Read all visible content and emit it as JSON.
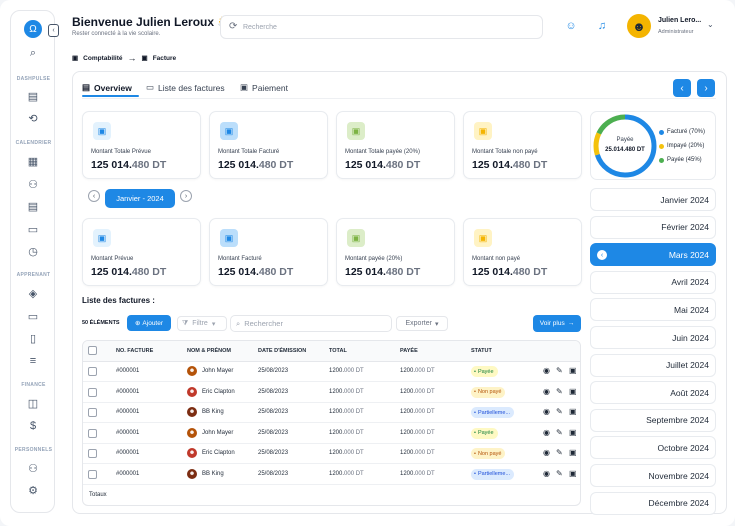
{
  "header": {
    "title": "Bienvenue Julien Leroux",
    "wave": "👋",
    "subtitle": "Rester connecté à la vie scolaire.",
    "search_placeholder": "Recherche"
  },
  "user": {
    "name": "Julien Leroux",
    "name_short": "Julien Lero...",
    "role": "Administrateur"
  },
  "breadcrumb": {
    "first": "Comptabilité",
    "second": "Facture"
  },
  "sidebar": {
    "sections": [
      "DASHPULSE",
      "CALENDRIER",
      "APPRENANT",
      "FINANCE",
      "PERSONNELS"
    ]
  },
  "tabs": [
    {
      "label": "Overview",
      "icon": "overview-icon"
    },
    {
      "label": "Liste des factures",
      "icon": "list-icon"
    },
    {
      "label": "Paiement",
      "icon": "payment-icon"
    }
  ],
  "summary_cards": [
    {
      "label": "Montant Totale Prévue",
      "value": "125 014.",
      "dec": "480 DT",
      "icon": "wallet-icon",
      "color": "#e3f2fd",
      "icolor": "#1e88e5"
    },
    {
      "label": "Montant Totale Facturé",
      "value": "125 014.",
      "dec": "480 DT",
      "icon": "clipboard-icon",
      "color": "#bbdefb",
      "icolor": "#1e88e5"
    },
    {
      "label": "Montant Totale payée (20%)",
      "value": "125 014.",
      "dec": "480 DT",
      "icon": "cash-icon",
      "color": "#dcedc8",
      "icolor": "#7cb342"
    },
    {
      "label": "Montant Totale non payé",
      "value": "125 014.",
      "dec": "480 DT",
      "icon": "cash-icon",
      "color": "#fff3c4",
      "icolor": "#f4b400"
    }
  ],
  "month_selector": {
    "label": "Janvier - 2024"
  },
  "month_cards": [
    {
      "label": "Montant  Prévue",
      "value": "125 014.",
      "dec": "480 DT"
    },
    {
      "label": "Montant  Facturé",
      "value": "125 014.",
      "dec": "480 DT"
    },
    {
      "label": "Montant  payée (20%)",
      "value": "125 014.",
      "dec": "480 DT"
    },
    {
      "label": "Montant  non payé",
      "value": "125 014.",
      "dec": "480 DT"
    }
  ],
  "ring": {
    "center_label": "Payée",
    "center_value": "25.014.480 DT",
    "legend": [
      {
        "label": "Facturé (70%)",
        "color": "#1e88e5",
        "pct": 70
      },
      {
        "label": "Impayé (20%)",
        "color": "#f4c20d",
        "pct": 20
      },
      {
        "label": "Payée (45%)",
        "color": "#4caf50",
        "pct": 45
      }
    ]
  },
  "months": [
    "Janvier 2024",
    "Février 2024",
    "Mars 2024",
    "Avril 2024",
    "Mai 2024",
    "Juin 2024",
    "Juillet 2024",
    "Août 2024",
    "Septembre 2024",
    "Octobre 2024",
    "Novembre 2024",
    "Décembre 2024"
  ],
  "active_month_index": 2,
  "list": {
    "title": "Liste des factures :",
    "count": "50 ÉLÉMENTS",
    "add": "Ajouter",
    "filter": "Filtre",
    "search_placeholder": "Rechercher",
    "export": "Exporter",
    "more": "Voir plus",
    "columns": [
      "NO. FACTURE",
      "NOM & PRÉNOM",
      "DATE D'ÉMISSION",
      "TOTAL",
      "PAYÉE",
      "STATUT"
    ],
    "totals_label": "Totaux",
    "rows": [
      {
        "no": "#000001",
        "name": "John Mayer",
        "date": "25/08/2023",
        "total": "1200.",
        "total_dec": "000 DT",
        "paid": "1200.",
        "paid_dec": "000 DT",
        "status": "Payée",
        "status_type": "green"
      },
      {
        "no": "#000001",
        "name": "Eric Clapton",
        "date": "25/08/2023",
        "total": "1200.",
        "total_dec": "000 DT",
        "paid": "1200.",
        "paid_dec": "000 DT",
        "status": "Non payé",
        "status_type": "orange"
      },
      {
        "no": "#000001",
        "name": "BB King",
        "date": "25/08/2023",
        "total": "1200.",
        "total_dec": "000 DT",
        "paid": "1200.",
        "paid_dec": "000 DT",
        "status": "Partielleme...",
        "status_type": "blue"
      },
      {
        "no": "#000001",
        "name": "John Mayer",
        "date": "25/08/2023",
        "total": "1200.",
        "total_dec": "000 DT",
        "paid": "1200.",
        "paid_dec": "000 DT",
        "status": "Payée",
        "status_type": "green"
      },
      {
        "no": "#000001",
        "name": "Eric Clapton",
        "date": "25/08/2023",
        "total": "1200.",
        "total_dec": "000 DT",
        "paid": "1200.",
        "paid_dec": "000 DT",
        "status": "Non payé",
        "status_type": "orange"
      },
      {
        "no": "#000001",
        "name": "BB King",
        "date": "25/08/2023",
        "total": "1200.",
        "total_dec": "000 DT",
        "paid": "1200.",
        "paid_dec": "000 DT",
        "status": "Partielleme...",
        "status_type": "blue"
      }
    ]
  }
}
